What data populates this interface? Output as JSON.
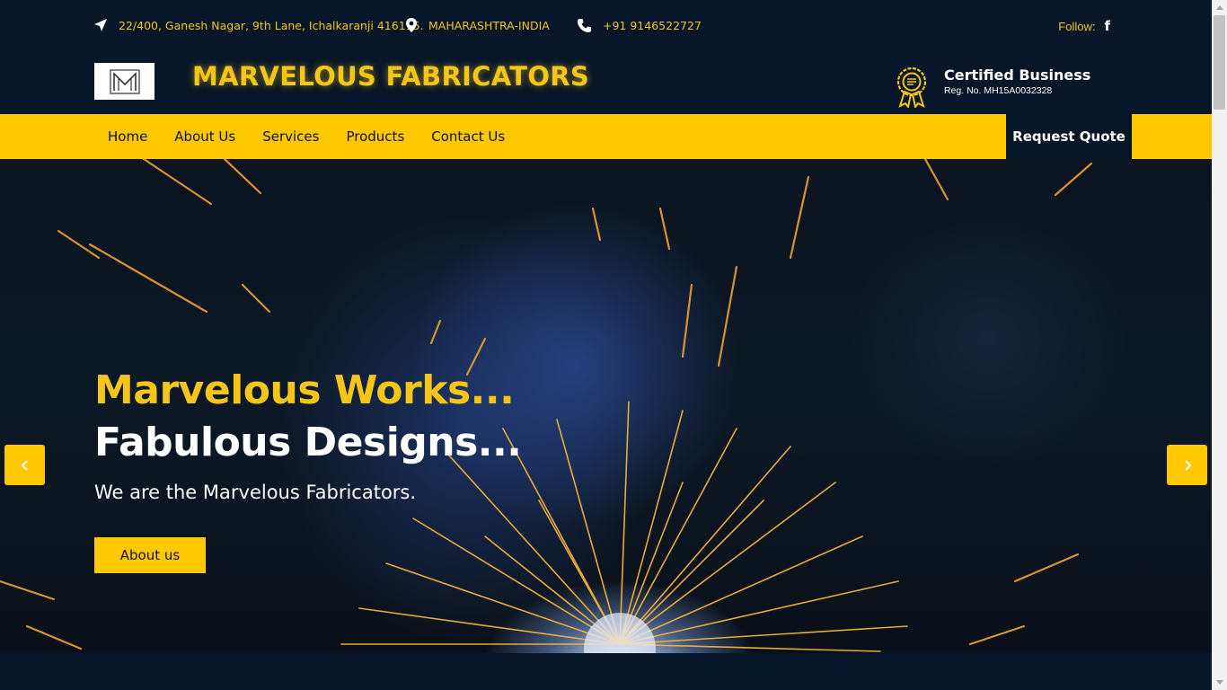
{
  "topbar": {
    "address": "22/400, Ganesh Nagar, 9th Lane, Ichalkaranji 416115.",
    "address_icon": "navigation-arrow-icon",
    "state": "MAHARASHTRA-INDIA",
    "state_icon": "map-pin-icon",
    "phone": "+91 9146522727",
    "phone_icon": "phone-icon",
    "follow_label": "Follow:",
    "facebook_glyph": "f",
    "facebook_icon": "facebook-icon"
  },
  "header": {
    "brand_name": "MARVELOUS FABRICATORS",
    "logo_icon": "m-monogram-logo",
    "certificate": {
      "title": "Certified Business",
      "reg_no": "Reg. No. MH15A0032328",
      "icon": "award-badge-icon"
    }
  },
  "nav": {
    "items": [
      {
        "label": "Home"
      },
      {
        "label": "About Us"
      },
      {
        "label": "Services"
      },
      {
        "label": "Products"
      },
      {
        "label": "Contact Us"
      }
    ],
    "quote_button": "Request Quote"
  },
  "hero": {
    "line1": "Marvelous Works...",
    "line2": "Fabulous Designs...",
    "tagline": "We are the Marvelous Fabricators.",
    "button": "About us",
    "prev_icon": "chevron-left-icon",
    "next_icon": "chevron-right-icon"
  },
  "colors": {
    "navy": "#071628",
    "accent_yellow": "#fdc800",
    "text_yellow": "#f5c518",
    "white": "#ffffff"
  }
}
